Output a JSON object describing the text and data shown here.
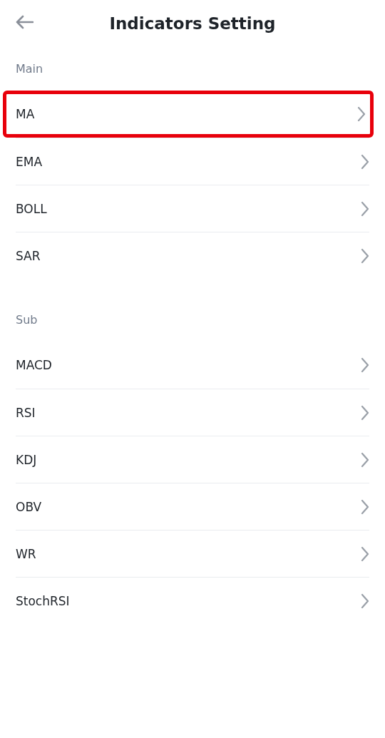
{
  "header": {
    "title": "Indicators Setting"
  },
  "sections": [
    {
      "title": "Main",
      "items": [
        {
          "label": "MA",
          "highlighted": true
        },
        {
          "label": "EMA",
          "highlighted": false
        },
        {
          "label": "BOLL",
          "highlighted": false
        },
        {
          "label": "SAR",
          "highlighted": false
        }
      ]
    },
    {
      "title": "Sub",
      "items": [
        {
          "label": "MACD",
          "highlighted": false
        },
        {
          "label": "RSI",
          "highlighted": false
        },
        {
          "label": "KDJ",
          "highlighted": false
        },
        {
          "label": "OBV",
          "highlighted": false
        },
        {
          "label": "WR",
          "highlighted": false
        },
        {
          "label": "StochRSI",
          "highlighted": false
        }
      ]
    }
  ]
}
